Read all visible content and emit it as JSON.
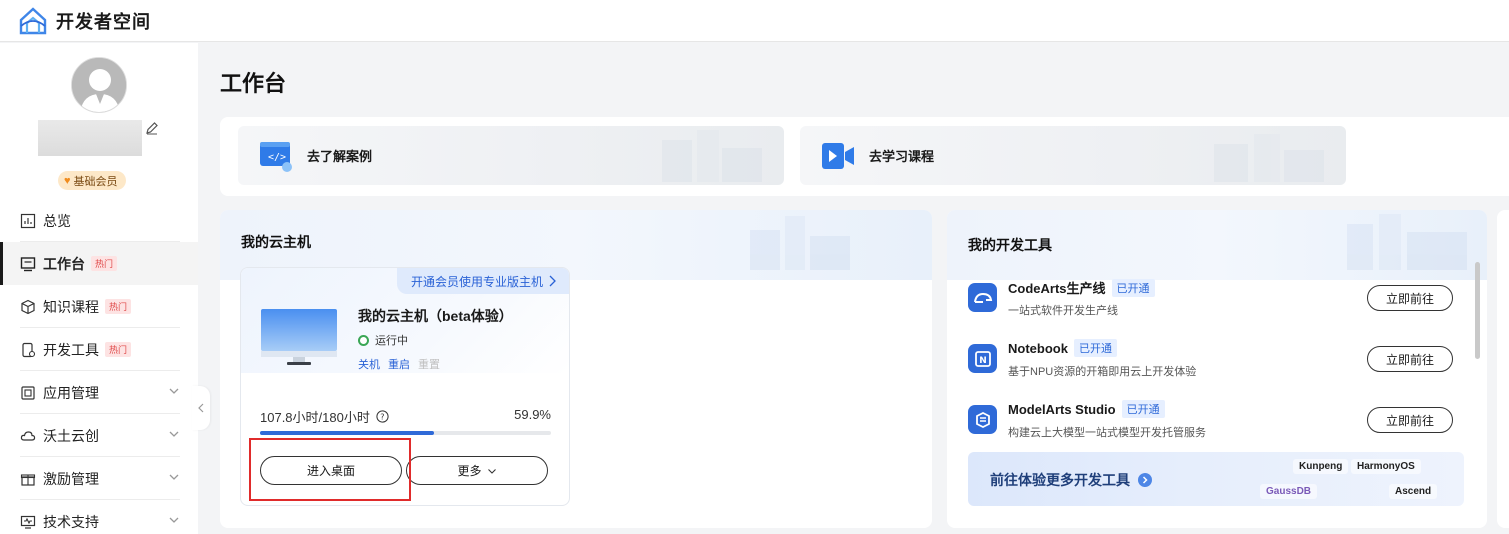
{
  "app": {
    "title": "开发者空间"
  },
  "user": {
    "badge": "基础会员"
  },
  "sidebar": {
    "items": [
      {
        "label": "总览",
        "icon": "chart-icon",
        "hot": "",
        "chevron": false,
        "active": false
      },
      {
        "label": "工作台",
        "icon": "workbench-icon",
        "hot": "热门",
        "chevron": false,
        "active": true
      },
      {
        "label": "知识课程",
        "icon": "cube-icon",
        "hot": "热门",
        "chevron": false,
        "active": false
      },
      {
        "label": "开发工具",
        "icon": "phone-gear-icon",
        "hot": "热门",
        "chevron": false,
        "active": false
      },
      {
        "label": "应用管理",
        "icon": "app-icon",
        "hot": "",
        "chevron": true,
        "active": false
      },
      {
        "label": "沃土云创",
        "icon": "cloud-icon",
        "hot": "",
        "chevron": true,
        "active": false
      },
      {
        "label": "激励管理",
        "icon": "gift-icon",
        "hot": "",
        "chevron": true,
        "active": false
      },
      {
        "label": "技术支持",
        "icon": "support-icon",
        "hot": "",
        "chevron": true,
        "active": false
      }
    ]
  },
  "page": {
    "title": "工作台"
  },
  "quick_links": [
    {
      "label": "去了解案例",
      "icon": "code-window-icon"
    },
    {
      "label": "去学习课程",
      "icon": "video-icon"
    }
  ],
  "cloud_host": {
    "panel_title": "我的云主机",
    "promo": "开通会员使用专业版主机",
    "name": "我的云主机（beta体验）",
    "status": "运行中",
    "status_color": "#3aa655",
    "actions": [
      "关机",
      "重启",
      "重置"
    ],
    "usage_text": "107.8小时/180小时",
    "usage_percent_text": "59.9%",
    "usage_percent": 59.9,
    "enter_button": "进入桌面",
    "more_button": "更多"
  },
  "dev_tools": {
    "panel_title": "我的开发工具",
    "tools": [
      {
        "name": "CodeArts生产线",
        "tag": "已开通",
        "desc": "一站式软件开发生产线",
        "button": "立即前往"
      },
      {
        "name": "Notebook",
        "tag": "已开通",
        "desc": "基于NPU资源的开箱即用云上开发体验",
        "button": "立即前往"
      },
      {
        "name": "ModelArts Studio",
        "tag": "已开通",
        "desc": "构建云上大模型一站式模型开发托管服务",
        "button": "立即前往"
      }
    ],
    "more_banner": "前往体验更多开发工具",
    "brands": [
      "Kunpeng",
      "HarmonyOS",
      "GaussDB",
      "Ascend"
    ]
  },
  "colors": {
    "accent": "#2f6ad8",
    "highlight": "#e02b2b"
  }
}
